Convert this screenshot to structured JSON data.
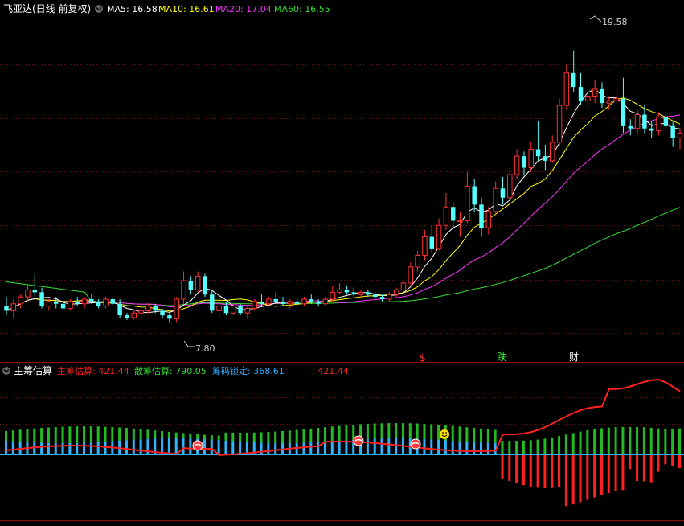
{
  "panel1": {
    "title": "飞亚达(日线 前复权)",
    "ma": [
      {
        "label": "MA5: 16.58",
        "color": "#ffffff"
      },
      {
        "label": "MA10: 16.61",
        "color": "#ffff00"
      },
      {
        "label": "MA20: 17.04",
        "color": "#ff33ff"
      },
      {
        "label": "MA60: 16.55",
        "color": "#33dd33"
      }
    ],
    "high_label": "19.58",
    "low_label": "7.80",
    "event_markers": [
      {
        "text": "$",
        "color": "#ff3333"
      },
      {
        "text": "跌",
        "color": "#33ff33"
      },
      {
        "text": "财",
        "color": "#ffffff"
      }
    ]
  },
  "panel2": {
    "title": "主筹估算",
    "items": [
      {
        "label": "主筹估算: 421.44",
        "color": "#ff2020"
      },
      {
        "label": "散筹估算: 790.05",
        "color": "#33dd33"
      },
      {
        "label": "筹码锁定: 368.61",
        "color": "#33aaff"
      },
      {
        "label": ": 421.44",
        "color": "#ff2020"
      }
    ]
  },
  "chart_data": {
    "type": "candlestick",
    "title": "飞亚达(日线 前复权)",
    "price_range": [
      6.5,
      21.0
    ],
    "annotations": {
      "high": 19.58,
      "low": 7.8
    },
    "moving_averages": {
      "MA5": 16.58,
      "MA10": 16.61,
      "MA20": 17.04,
      "MA60": 16.55
    },
    "candles": [
      {
        "o": 8.5,
        "h": 8.9,
        "l": 8.1,
        "c": 8.3
      },
      {
        "o": 8.3,
        "h": 8.8,
        "l": 8.0,
        "c": 8.6
      },
      {
        "o": 8.6,
        "h": 9.0,
        "l": 8.4,
        "c": 8.9
      },
      {
        "o": 8.9,
        "h": 9.4,
        "l": 8.7,
        "c": 9.2
      },
      {
        "o": 9.2,
        "h": 9.9,
        "l": 8.9,
        "c": 9.1
      },
      {
        "o": 9.1,
        "h": 9.3,
        "l": 8.4,
        "c": 8.5
      },
      {
        "o": 8.5,
        "h": 8.8,
        "l": 8.3,
        "c": 8.7
      },
      {
        "o": 8.7,
        "h": 8.9,
        "l": 8.4,
        "c": 8.6
      },
      {
        "o": 8.6,
        "h": 8.7,
        "l": 8.3,
        "c": 8.4
      },
      {
        "o": 8.4,
        "h": 8.8,
        "l": 8.3,
        "c": 8.7
      },
      {
        "o": 8.7,
        "h": 8.9,
        "l": 8.5,
        "c": 8.6
      },
      {
        "o": 8.6,
        "h": 8.9,
        "l": 8.4,
        "c": 8.8
      },
      {
        "o": 8.8,
        "h": 9.0,
        "l": 8.6,
        "c": 8.7
      },
      {
        "o": 8.7,
        "h": 8.8,
        "l": 8.4,
        "c": 8.5
      },
      {
        "o": 8.5,
        "h": 8.9,
        "l": 8.4,
        "c": 8.8
      },
      {
        "o": 8.8,
        "h": 8.9,
        "l": 8.5,
        "c": 8.6
      },
      {
        "o": 8.6,
        "h": 8.8,
        "l": 8.0,
        "c": 8.1
      },
      {
        "o": 8.1,
        "h": 8.2,
        "l": 7.9,
        "c": 8.0
      },
      {
        "o": 8.0,
        "h": 8.3,
        "l": 7.9,
        "c": 8.2
      },
      {
        "o": 8.2,
        "h": 8.4,
        "l": 8.0,
        "c": 8.3
      },
      {
        "o": 8.3,
        "h": 8.6,
        "l": 8.2,
        "c": 8.5
      },
      {
        "o": 8.5,
        "h": 8.6,
        "l": 8.2,
        "c": 8.3
      },
      {
        "o": 8.3,
        "h": 8.4,
        "l": 8.0,
        "c": 8.1
      },
      {
        "o": 8.1,
        "h": 8.2,
        "l": 7.8,
        "c": 7.95
      },
      {
        "o": 7.95,
        "h": 8.9,
        "l": 7.8,
        "c": 8.8
      },
      {
        "o": 8.8,
        "h": 10.0,
        "l": 8.6,
        "c": 9.6
      },
      {
        "o": 9.6,
        "h": 9.8,
        "l": 9.0,
        "c": 9.2
      },
      {
        "o": 9.2,
        "h": 10.0,
        "l": 9.1,
        "c": 9.8
      },
      {
        "o": 9.8,
        "h": 9.9,
        "l": 8.9,
        "c": 9.0
      },
      {
        "o": 9.0,
        "h": 9.2,
        "l": 8.2,
        "c": 8.3
      },
      {
        "o": 8.3,
        "h": 8.6,
        "l": 8.0,
        "c": 8.5
      },
      {
        "o": 8.5,
        "h": 8.7,
        "l": 8.1,
        "c": 8.2
      },
      {
        "o": 8.2,
        "h": 8.6,
        "l": 8.1,
        "c": 8.5
      },
      {
        "o": 8.5,
        "h": 8.6,
        "l": 8.1,
        "c": 8.2
      },
      {
        "o": 8.2,
        "h": 8.5,
        "l": 8.0,
        "c": 8.4
      },
      {
        "o": 8.4,
        "h": 8.8,
        "l": 8.3,
        "c": 8.7
      },
      {
        "o": 8.7,
        "h": 9.0,
        "l": 8.5,
        "c": 8.6
      },
      {
        "o": 8.6,
        "h": 8.9,
        "l": 8.5,
        "c": 8.8
      },
      {
        "o": 8.8,
        "h": 9.1,
        "l": 8.6,
        "c": 8.7
      },
      {
        "o": 8.7,
        "h": 8.9,
        "l": 8.5,
        "c": 8.6
      },
      {
        "o": 8.6,
        "h": 8.8,
        "l": 8.4,
        "c": 8.7
      },
      {
        "o": 8.7,
        "h": 8.9,
        "l": 8.5,
        "c": 8.6
      },
      {
        "o": 8.6,
        "h": 8.9,
        "l": 8.5,
        "c": 8.8
      },
      {
        "o": 8.8,
        "h": 9.0,
        "l": 8.6,
        "c": 8.7
      },
      {
        "o": 8.7,
        "h": 8.8,
        "l": 8.5,
        "c": 8.6
      },
      {
        "o": 8.6,
        "h": 8.9,
        "l": 8.5,
        "c": 8.8
      },
      {
        "o": 8.8,
        "h": 9.4,
        "l": 8.7,
        "c": 9.1
      },
      {
        "o": 9.1,
        "h": 9.5,
        "l": 9.0,
        "c": 9.2
      },
      {
        "o": 9.2,
        "h": 9.4,
        "l": 9.0,
        "c": 9.1
      },
      {
        "o": 9.1,
        "h": 9.3,
        "l": 8.9,
        "c": 9.0
      },
      {
        "o": 9.0,
        "h": 9.2,
        "l": 8.9,
        "c": 9.1
      },
      {
        "o": 9.1,
        "h": 9.2,
        "l": 8.9,
        "c": 9.0
      },
      {
        "o": 9.0,
        "h": 9.1,
        "l": 8.8,
        "c": 8.9
      },
      {
        "o": 8.9,
        "h": 9.0,
        "l": 8.7,
        "c": 8.8
      },
      {
        "o": 8.8,
        "h": 9.1,
        "l": 8.7,
        "c": 9.0
      },
      {
        "o": 9.0,
        "h": 9.3,
        "l": 8.9,
        "c": 9.2
      },
      {
        "o": 9.2,
        "h": 9.6,
        "l": 9.1,
        "c": 9.5
      },
      {
        "o": 9.5,
        "h": 10.4,
        "l": 9.4,
        "c": 10.2
      },
      {
        "o": 10.2,
        "h": 10.9,
        "l": 10.0,
        "c": 10.7
      },
      {
        "o": 10.7,
        "h": 11.8,
        "l": 10.5,
        "c": 11.5
      },
      {
        "o": 11.5,
        "h": 12.0,
        "l": 10.8,
        "c": 11.0
      },
      {
        "o": 11.0,
        "h": 12.3,
        "l": 10.9,
        "c": 12.0
      },
      {
        "o": 12.0,
        "h": 13.4,
        "l": 11.8,
        "c": 12.8
      },
      {
        "o": 12.8,
        "h": 13.0,
        "l": 11.9,
        "c": 12.2
      },
      {
        "o": 12.2,
        "h": 12.6,
        "l": 11.5,
        "c": 12.2
      },
      {
        "o": 12.2,
        "h": 14.3,
        "l": 12.1,
        "c": 13.7
      },
      {
        "o": 13.7,
        "h": 14.0,
        "l": 12.6,
        "c": 12.9
      },
      {
        "o": 12.9,
        "h": 13.2,
        "l": 11.5,
        "c": 11.9
      },
      {
        "o": 11.9,
        "h": 12.8,
        "l": 11.6,
        "c": 12.6
      },
      {
        "o": 12.6,
        "h": 13.9,
        "l": 12.4,
        "c": 13.6
      },
      {
        "o": 13.6,
        "h": 14.1,
        "l": 12.9,
        "c": 13.2
      },
      {
        "o": 13.2,
        "h": 14.5,
        "l": 13.1,
        "c": 14.2
      },
      {
        "o": 14.2,
        "h": 15.3,
        "l": 14.0,
        "c": 15.0
      },
      {
        "o": 15.0,
        "h": 15.2,
        "l": 14.2,
        "c": 14.5
      },
      {
        "o": 14.5,
        "h": 15.6,
        "l": 14.3,
        "c": 15.3
      },
      {
        "o": 15.3,
        "h": 16.5,
        "l": 14.8,
        "c": 15.0
      },
      {
        "o": 15.0,
        "h": 15.5,
        "l": 14.4,
        "c": 14.8
      },
      {
        "o": 14.8,
        "h": 15.9,
        "l": 14.7,
        "c": 15.6
      },
      {
        "o": 15.6,
        "h": 17.5,
        "l": 15.4,
        "c": 17.2
      },
      {
        "o": 17.2,
        "h": 19.0,
        "l": 17.0,
        "c": 18.6
      },
      {
        "o": 18.6,
        "h": 19.58,
        "l": 17.8,
        "c": 18.0
      },
      {
        "o": 18.0,
        "h": 18.6,
        "l": 17.2,
        "c": 17.4
      },
      {
        "o": 17.4,
        "h": 17.8,
        "l": 17.0,
        "c": 17.6
      },
      {
        "o": 17.6,
        "h": 18.3,
        "l": 17.3,
        "c": 17.9
      },
      {
        "o": 17.9,
        "h": 18.2,
        "l": 17.1,
        "c": 17.3
      },
      {
        "o": 17.3,
        "h": 17.6,
        "l": 17.0,
        "c": 17.4
      },
      {
        "o": 17.4,
        "h": 17.9,
        "l": 17.2,
        "c": 17.5
      },
      {
        "o": 17.5,
        "h": 18.4,
        "l": 16.0,
        "c": 16.3
      },
      {
        "o": 16.3,
        "h": 16.6,
        "l": 15.9,
        "c": 16.2
      },
      {
        "o": 16.2,
        "h": 17.0,
        "l": 16.0,
        "c": 16.8
      },
      {
        "o": 16.8,
        "h": 17.2,
        "l": 16.0,
        "c": 16.2
      },
      {
        "o": 16.2,
        "h": 16.5,
        "l": 15.8,
        "c": 16.1
      },
      {
        "o": 16.1,
        "h": 16.9,
        "l": 15.9,
        "c": 16.7
      },
      {
        "o": 16.7,
        "h": 16.9,
        "l": 16.1,
        "c": 16.3
      },
      {
        "o": 16.3,
        "h": 16.5,
        "l": 15.4,
        "c": 15.8
      },
      {
        "o": 15.8,
        "h": 16.2,
        "l": 15.3,
        "c": 16.0
      }
    ],
    "indicator": {
      "title": "主筹估算",
      "values": {
        "主筹估算": 421.44,
        "散筹估算": 790.05,
        "筹码锁定": 368.61,
        "": 421.44
      }
    }
  }
}
